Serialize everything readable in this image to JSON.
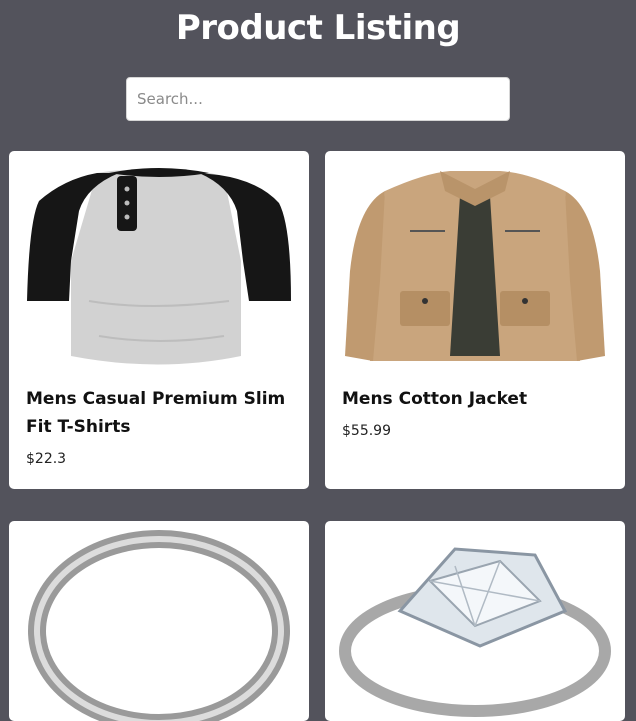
{
  "header": {
    "title": "Product Listing"
  },
  "search": {
    "placeholder": "Search...",
    "value": ""
  },
  "products": [
    {
      "title": "Mens Casual Premium Slim Fit T-Shirts",
      "price": "$22.3",
      "image": "raglan-tshirt-image"
    },
    {
      "title": "Mens Cotton Jacket",
      "price": "$55.99",
      "image": "cotton-jacket-image"
    },
    {
      "title": "",
      "price": "",
      "image": "silver-ring-image"
    },
    {
      "title": "",
      "price": "",
      "image": "diamond-ring-image"
    }
  ],
  "colors": {
    "background": "#53535c",
    "card": "#ffffff",
    "jacket": "#c9a57d"
  }
}
